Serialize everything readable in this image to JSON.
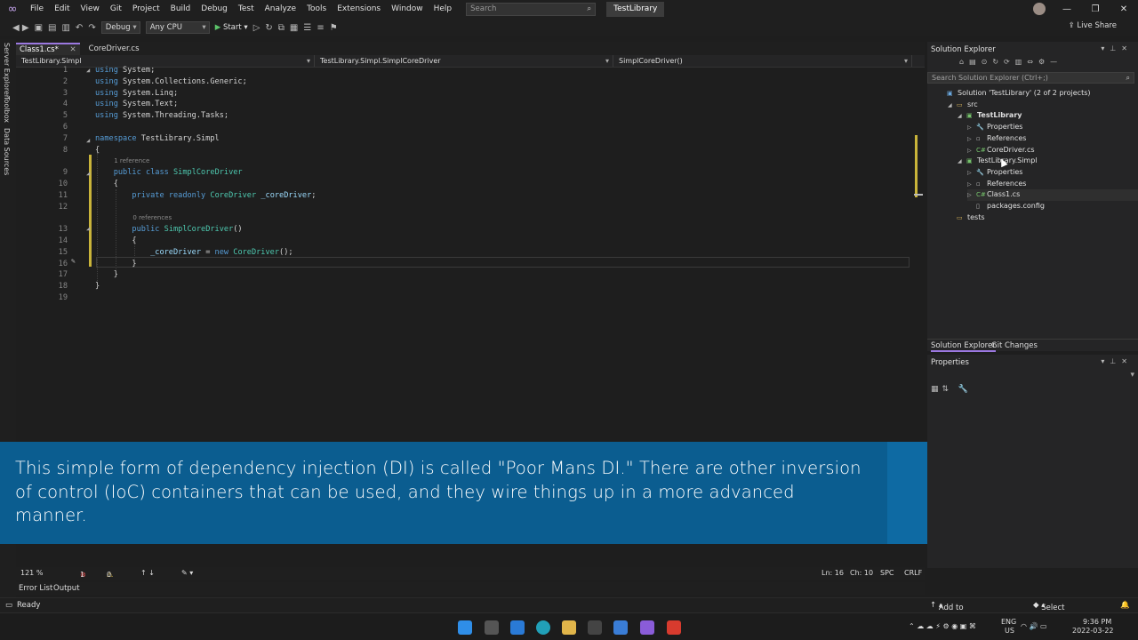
{
  "menu": {
    "items": [
      "File",
      "Edit",
      "View",
      "Git",
      "Project",
      "Build",
      "Debug",
      "Test",
      "Analyze",
      "Tools",
      "Extensions",
      "Window",
      "Help"
    ],
    "search_placeholder": "Search",
    "solution_name": "TestLibrary"
  },
  "toolbar": {
    "config": "Debug",
    "platform": "Any CPU",
    "start_label": "Start",
    "live_share": "Live Share"
  },
  "left_tabs": [
    "Server Explorer",
    "Toolbox",
    "Data Sources"
  ],
  "editor": {
    "tabs": [
      {
        "label": "Class1.cs*",
        "active": true
      },
      {
        "label": "CoreDriver.cs",
        "active": false
      }
    ],
    "nav": [
      "TestLibrary.Simpl",
      "TestLibrary.Simpl.SimplCoreDriver",
      "SimplCoreDriver()"
    ],
    "lines": [
      {
        "n": "1",
        "tokens": [
          [
            "kw",
            "using"
          ],
          [
            "plain",
            " System;"
          ]
        ]
      },
      {
        "n": "2",
        "tokens": [
          [
            "kw",
            "using"
          ],
          [
            "plain",
            " System.Collections.Generic;"
          ]
        ]
      },
      {
        "n": "3",
        "tokens": [
          [
            "kw",
            "using"
          ],
          [
            "plain",
            " System.Linq;"
          ]
        ]
      },
      {
        "n": "4",
        "tokens": [
          [
            "kw",
            "using"
          ],
          [
            "plain",
            " System.Text;"
          ]
        ]
      },
      {
        "n": "5",
        "tokens": [
          [
            "kw",
            "using"
          ],
          [
            "plain",
            " System.Threading.Tasks;"
          ]
        ]
      },
      {
        "n": "6",
        "tokens": []
      },
      {
        "n": "7",
        "tokens": [
          [
            "kw",
            "namespace"
          ],
          [
            "plain",
            " TestLibrary.Simpl"
          ]
        ]
      },
      {
        "n": "8",
        "tokens": [
          [
            "plain",
            "{"
          ]
        ]
      },
      {
        "n": "",
        "hint": "1 reference",
        "indent": 4
      },
      {
        "n": "9",
        "tokens": [
          [
            "plain",
            "    "
          ],
          [
            "kw",
            "public"
          ],
          [
            "plain",
            " "
          ],
          [
            "kw",
            "class"
          ],
          [
            "plain",
            " "
          ],
          [
            "ty",
            "SimplCoreDriver"
          ]
        ]
      },
      {
        "n": "10",
        "tokens": [
          [
            "plain",
            "    {"
          ]
        ]
      },
      {
        "n": "11",
        "tokens": [
          [
            "plain",
            "        "
          ],
          [
            "kw",
            "private"
          ],
          [
            "plain",
            " "
          ],
          [
            "kw",
            "readonly"
          ],
          [
            "plain",
            " "
          ],
          [
            "ty",
            "CoreDriver"
          ],
          [
            "plain",
            " "
          ],
          [
            "id",
            "_coreDriver"
          ],
          [
            "plain",
            ";"
          ]
        ]
      },
      {
        "n": "12",
        "tokens": []
      },
      {
        "n": "",
        "hint": "0 references",
        "indent": 8
      },
      {
        "n": "13",
        "tokens": [
          [
            "plain",
            "        "
          ],
          [
            "kw",
            "public"
          ],
          [
            "plain",
            " "
          ],
          [
            "ty",
            "SimplCoreDriver"
          ],
          [
            "plain",
            "()"
          ]
        ]
      },
      {
        "n": "14",
        "tokens": [
          [
            "plain",
            "        {"
          ]
        ]
      },
      {
        "n": "15",
        "tokens": [
          [
            "plain",
            "            "
          ],
          [
            "id",
            "_coreDriver"
          ],
          [
            "plain",
            " = "
          ],
          [
            "kw",
            "new"
          ],
          [
            "plain",
            " "
          ],
          [
            "ty",
            "CoreDriver"
          ],
          [
            "plain",
            "();"
          ]
        ]
      },
      {
        "n": "16",
        "tokens": [
          [
            "plain",
            "        }"
          ]
        ]
      },
      {
        "n": "17",
        "tokens": [
          [
            "plain",
            "    }"
          ]
        ]
      },
      {
        "n": "18",
        "tokens": [
          [
            "plain",
            "}"
          ]
        ]
      },
      {
        "n": "19",
        "tokens": []
      }
    ]
  },
  "caption": "This simple form of dependency injection (DI) is called \"Poor Mans DI.\" There are other inversion of control (IoC) containers that can be used, and they wire things up in a more advanced manner.",
  "editor_status": {
    "zoom": "121 %",
    "errors": "1",
    "warnings": "0",
    "position": "Ln: 16",
    "column": "Ch: 10",
    "spacing": "SPC",
    "line_endings": "CRLF"
  },
  "bottom_tabs": [
    "Error List",
    "Output"
  ],
  "statusbar": {
    "state": "Ready",
    "source_control": "Add to Source Control",
    "repository": "Select Repository"
  },
  "solution_explorer": {
    "title": "Solution Explorer",
    "search_placeholder": "Search Solution Explorer (Ctrl+;)",
    "tree": [
      {
        "label": "Solution 'TestLibrary' (2 of 2 projects)",
        "depth": 0,
        "icon": "solution",
        "arrow": ""
      },
      {
        "label": "src",
        "depth": 1,
        "icon": "folder",
        "arrow": "open"
      },
      {
        "label": "TestLibrary",
        "depth": 2,
        "icon": "project",
        "arrow": "open",
        "bold": true
      },
      {
        "label": "Properties",
        "depth": 3,
        "icon": "wrench",
        "arrow": "closed"
      },
      {
        "label": "References",
        "depth": 3,
        "icon": "refs",
        "arrow": "closed"
      },
      {
        "label": "CoreDriver.cs",
        "depth": 3,
        "icon": "cs",
        "arrow": "closed"
      },
      {
        "label": "TestLibrary.Simpl",
        "depth": 2,
        "icon": "project",
        "arrow": "open"
      },
      {
        "label": "Properties",
        "depth": 3,
        "icon": "wrench",
        "arrow": "closed"
      },
      {
        "label": "References",
        "depth": 3,
        "icon": "refs",
        "arrow": "closed"
      },
      {
        "label": "Class1.cs",
        "depth": 3,
        "icon": "cs",
        "arrow": "closed",
        "selected": true
      },
      {
        "label": "packages.config",
        "depth": 3,
        "icon": "file",
        "arrow": ""
      },
      {
        "label": "tests",
        "depth": 1,
        "icon": "folder",
        "arrow": ""
      }
    ],
    "tabs": [
      "Solution Explorer",
      "Git Changes"
    ]
  },
  "properties": {
    "title": "Properties"
  },
  "taskbar": {
    "lang": "ENG",
    "region": "US",
    "time": "9:36 PM",
    "date": "2022-03-22"
  }
}
